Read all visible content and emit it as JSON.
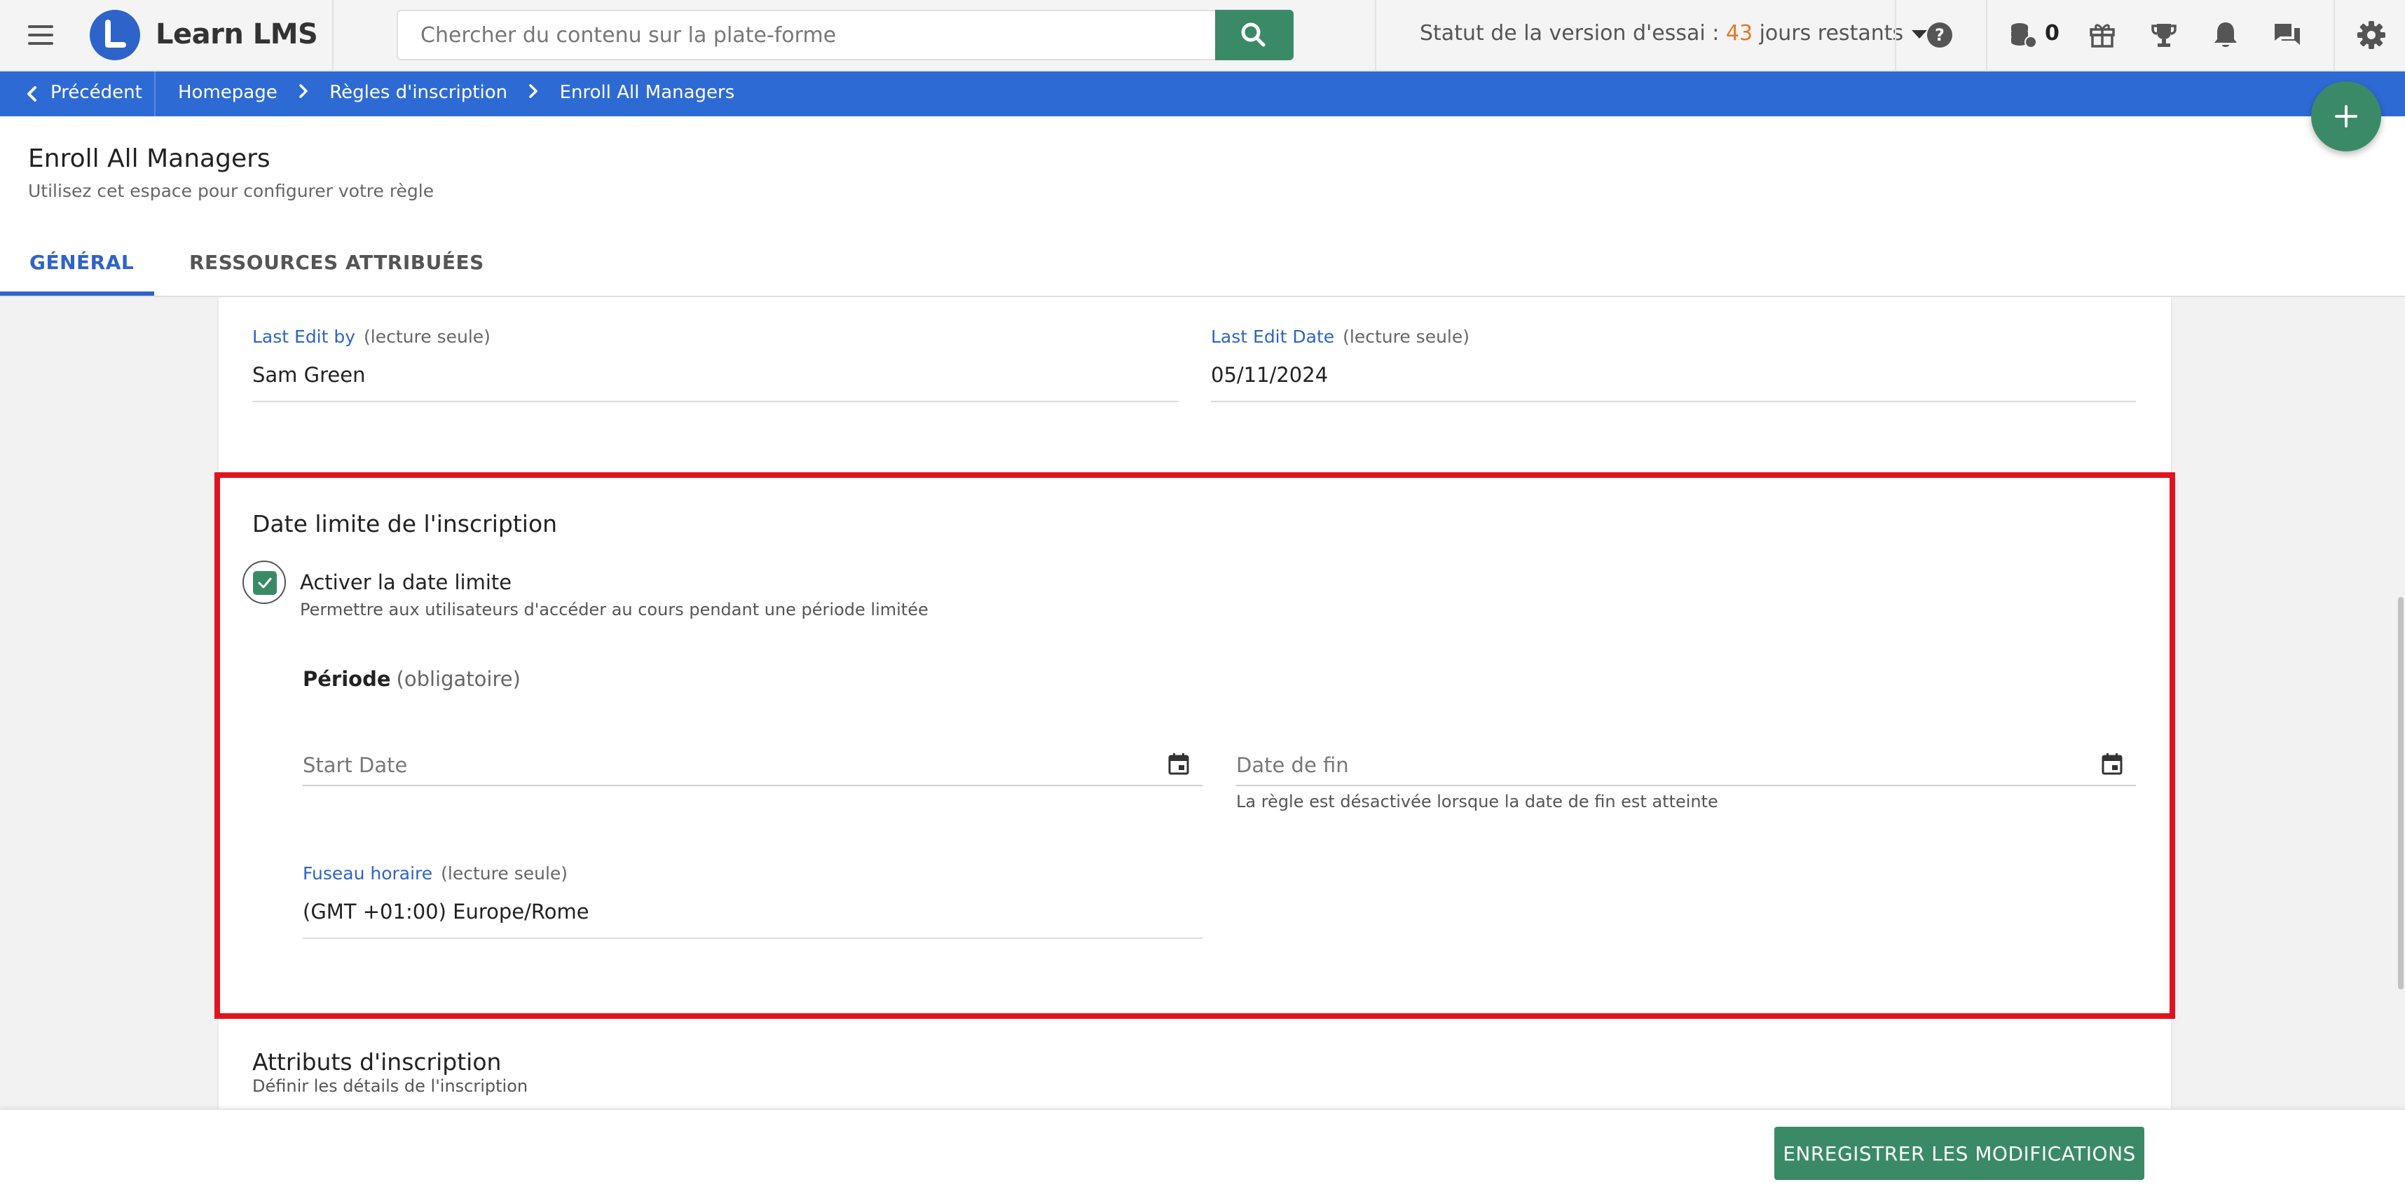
{
  "header": {
    "app_name": "Learn LMS",
    "search_placeholder": "Chercher du contenu sur la plate-forme",
    "trial_prefix": "Statut de la version d'essai : ",
    "trial_days": "43",
    "trial_suffix": " jours restants",
    "coin_count": "0",
    "icons": [
      "menu-icon",
      "search-icon",
      "help-icon",
      "coins-icon",
      "gift-icon",
      "trophy-icon",
      "bell-icon",
      "chat-icon",
      "gear-icon"
    ],
    "accent": "#3a8a68",
    "brand": "#2e63c9"
  },
  "breadcrumb": {
    "back_label": "Précédent",
    "items": [
      "Homepage",
      "Règles d'inscription",
      "Enroll All Managers"
    ],
    "bar_color": "#2e6ad3"
  },
  "page": {
    "title": "Enroll All Managers",
    "subtitle": "Utilisez cet espace pour configurer votre règle"
  },
  "tabs": [
    {
      "label": "GÉNÉRAL",
      "active": true
    },
    {
      "label": "RESSOURCES ATTRIBUÉES",
      "active": false
    }
  ],
  "fields": {
    "last_edit_by": {
      "label": "Last Edit by",
      "note": "(lecture seule)",
      "value": "Sam Green"
    },
    "last_edit_date": {
      "label": "Last Edit Date",
      "note": "(lecture seule)",
      "value": "05/11/2024"
    }
  },
  "deadline": {
    "title": "Date limite de l'inscription",
    "checkbox_label": "Activer la date limite",
    "checkbox_checked": true,
    "checkbox_desc": "Permettre aux utilisateurs d'accéder au cours pendant une période limitée",
    "period_label": "Période",
    "period_required": "(obligatoire)",
    "start_placeholder": "Start Date",
    "end_placeholder": "Date de fin",
    "end_hint": "La règle est désactivée lorsque la date de fin est atteinte",
    "timezone": {
      "label": "Fuseau horaire",
      "note": "(lecture seule)",
      "value": "(GMT +01:00) Europe/Rome"
    },
    "highlight_color": "#e0141e"
  },
  "attributes": {
    "title": "Attributs d'inscription",
    "desc": "Définir les détails de l'inscription"
  },
  "footer": {
    "save_label": "ENREGISTRER LES MODIFICATIONS"
  }
}
